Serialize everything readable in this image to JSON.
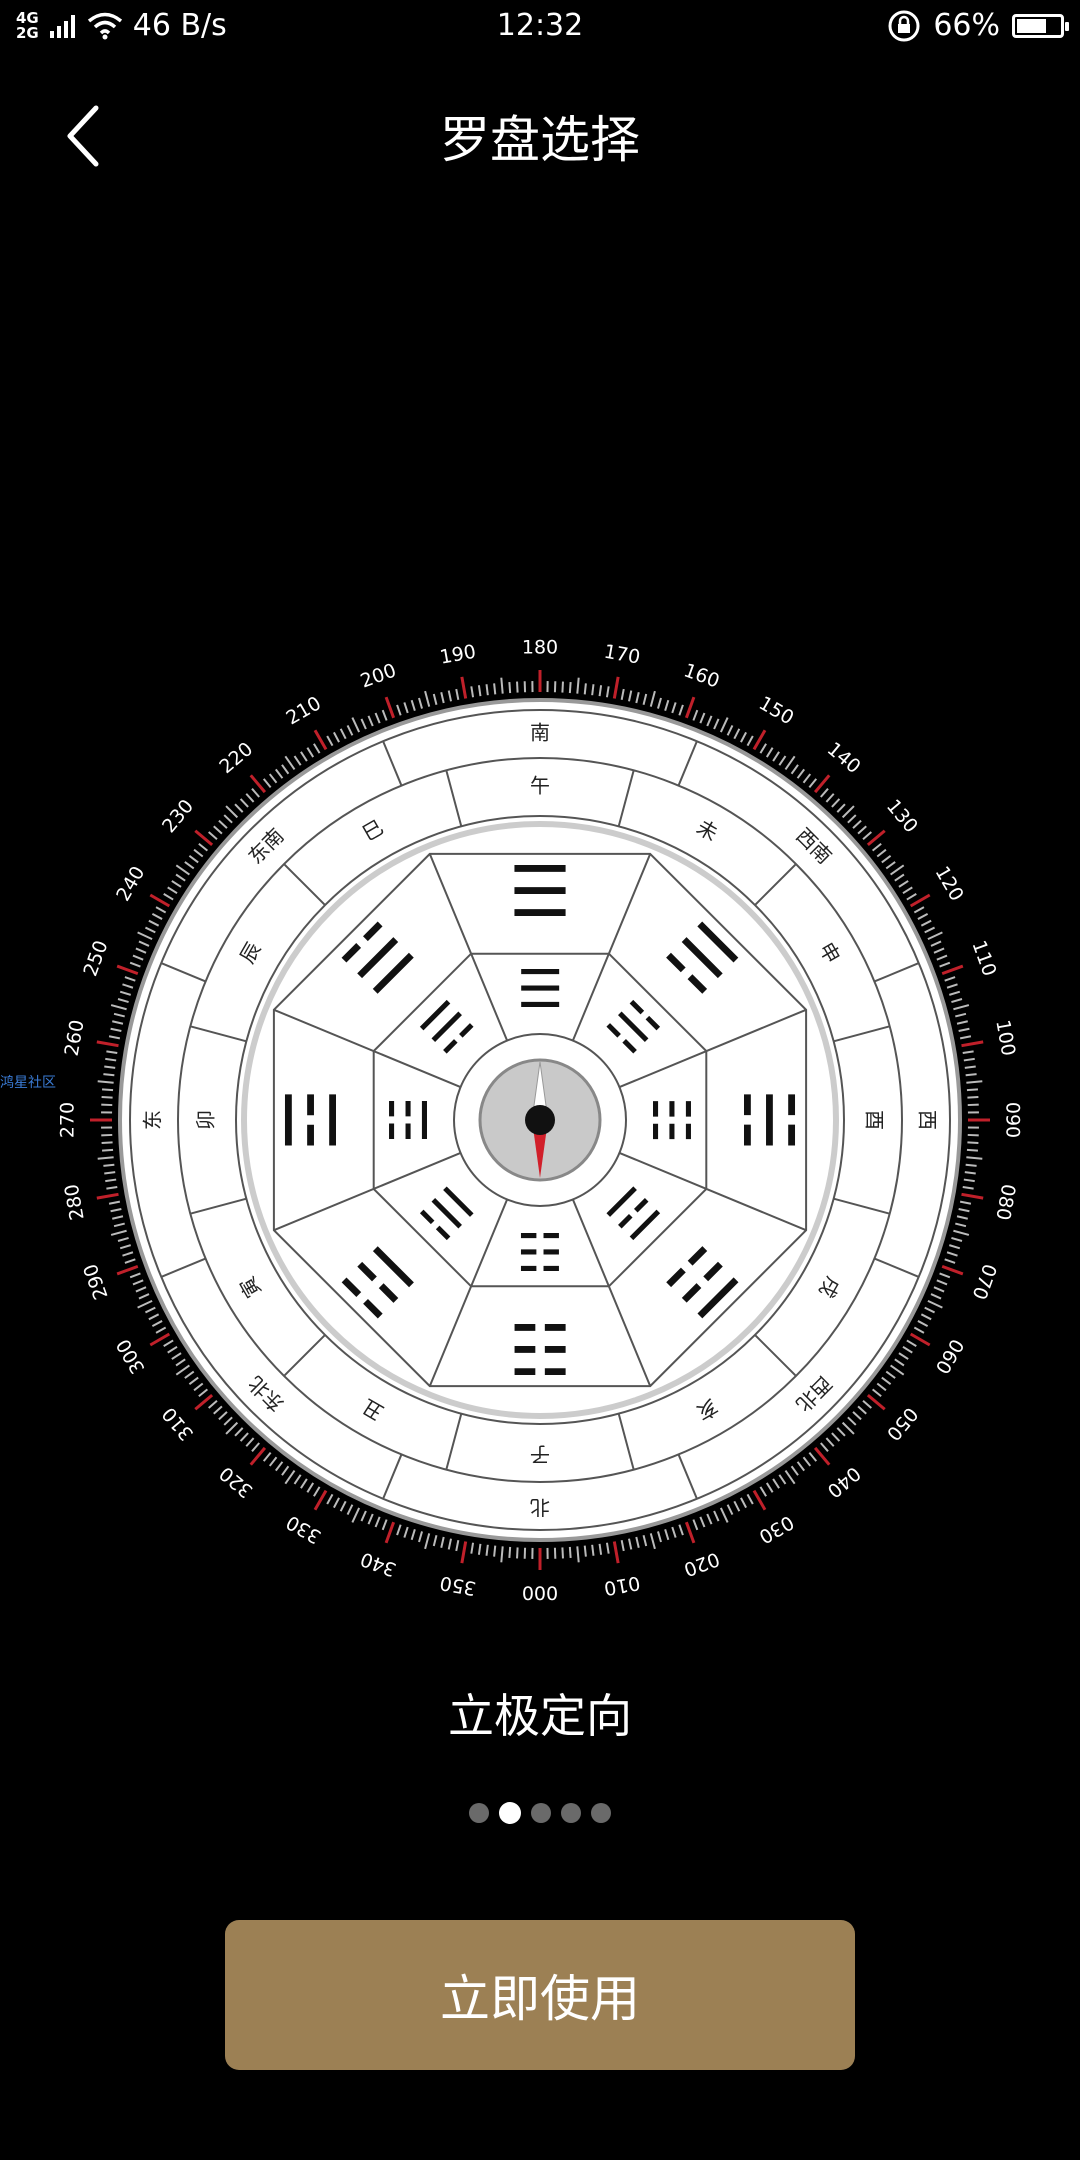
{
  "status_bar": {
    "network_top": "4G",
    "network_bottom": "2G",
    "speed": "46 B/s",
    "time": "12:32",
    "battery_percent": "66%",
    "battery_level": 0.66
  },
  "header": {
    "title": "罗盘选择"
  },
  "compass": {
    "degree_labels": [
      "000",
      "010",
      "020",
      "030",
      "040",
      "050",
      "060",
      "070",
      "080",
      "090",
      "100",
      "110",
      "120",
      "130",
      "140",
      "150",
      "160",
      "170",
      "180",
      "190",
      "200",
      "210",
      "220",
      "230",
      "240",
      "250",
      "260",
      "270",
      "280",
      "290",
      "300",
      "310",
      "320",
      "330",
      "340",
      "350"
    ],
    "directions": [
      "南",
      "西南",
      "西",
      "西北",
      "北",
      "东北",
      "东",
      "东南"
    ],
    "branches": [
      "午",
      "未",
      "申",
      "酉",
      "戌",
      "亥",
      "子",
      "丑",
      "寅",
      "卯",
      "辰",
      "巳"
    ],
    "outer_trigrams": [
      "☰",
      "☴",
      "☵",
      "☶",
      "☷",
      "☳",
      "☲",
      "☱"
    ],
    "inner_trigrams": [
      "☰",
      "☵",
      "☷",
      "☲",
      "☷",
      "☱",
      "☳",
      "☴"
    ]
  },
  "side_tag": "鸿星社区",
  "mode": {
    "label": "立极定向"
  },
  "pager": {
    "count": 5,
    "active_index": 1
  },
  "actions": {
    "use_label": "立即使用"
  },
  "colors": {
    "button": "#9c8054",
    "needle_red": "#d11f2a",
    "tick_red": "#c0202a"
  }
}
